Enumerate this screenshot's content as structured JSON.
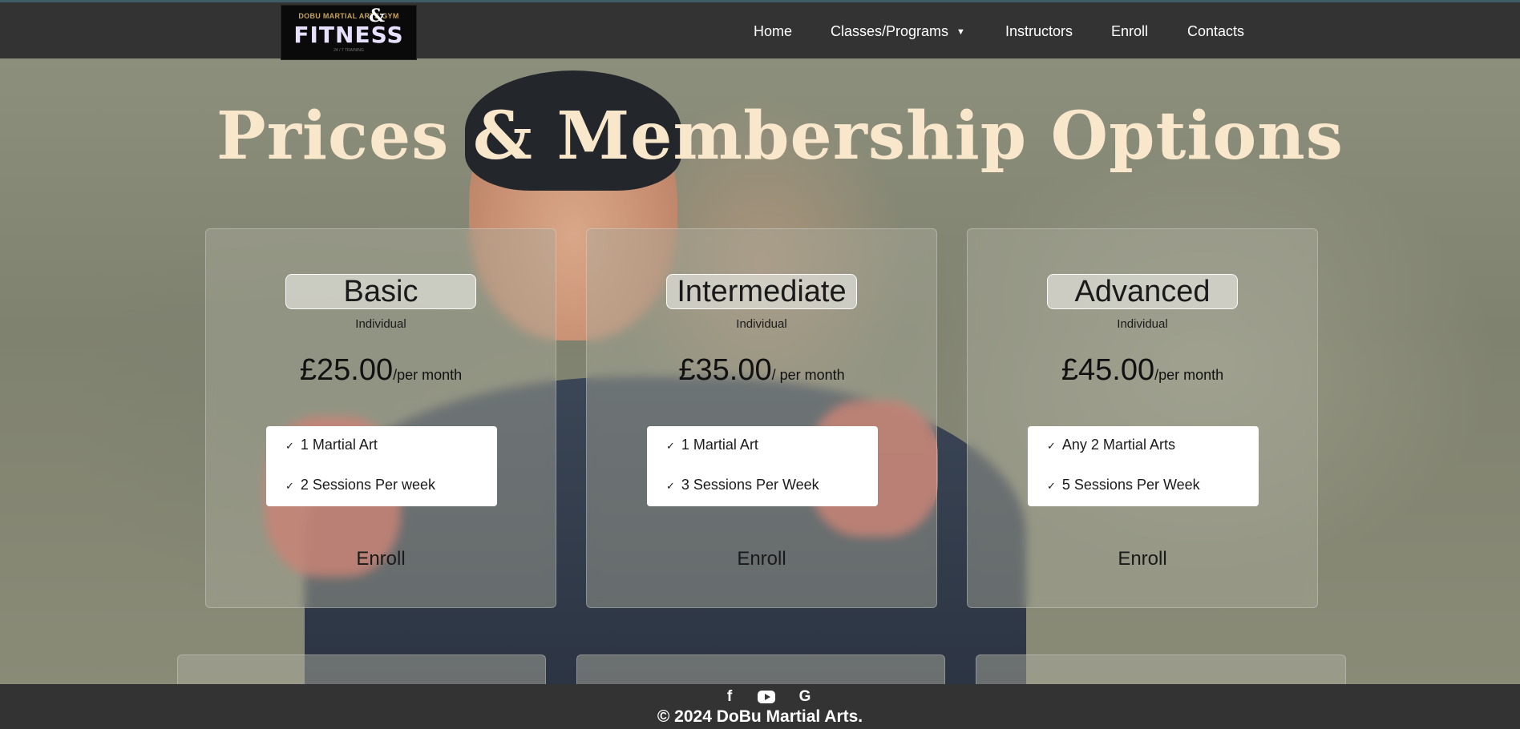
{
  "logo": {
    "top_text": "DOBU MARTIAL ARTS GYM",
    "amp": "&",
    "main_text": "FITNESS",
    "sub_text": "24 / 7 TRAINING"
  },
  "nav": {
    "home": "Home",
    "classes": "Classes/Programs",
    "instructors": "Instructors",
    "enroll": "Enroll",
    "contacts": "Contacts"
  },
  "page_title": "Prices & Membership Options",
  "plans": [
    {
      "name": "Basic",
      "type": "Individual",
      "amount": "£25.00",
      "per": "/per month",
      "features": [
        "1 Martial Art",
        "2 Sessions Per week"
      ],
      "enroll": "Enroll"
    },
    {
      "name": "Intermediate",
      "type": "Individual",
      "amount": "£35.00",
      "per": "/ per month",
      "features": [
        "1 Martial Art",
        "3 Sessions Per Week"
      ],
      "enroll": "Enroll"
    },
    {
      "name": "Advanced",
      "type": "Individual",
      "amount": "£45.00",
      "per": "/per month",
      "features": [
        "Any 2 Martial Arts",
        "5 Sessions Per Week"
      ],
      "enroll": "Enroll"
    }
  ],
  "footer": {
    "social_icons": [
      "facebook-icon",
      "youtube-icon",
      "google-icon"
    ],
    "facebook_glyph": "f",
    "google_glyph": "G",
    "copyright": "© 2024 DoBu Martial Arts."
  },
  "colors": {
    "topbar": "#333333",
    "title": "#f9e7cc",
    "footer": "#333333"
  }
}
